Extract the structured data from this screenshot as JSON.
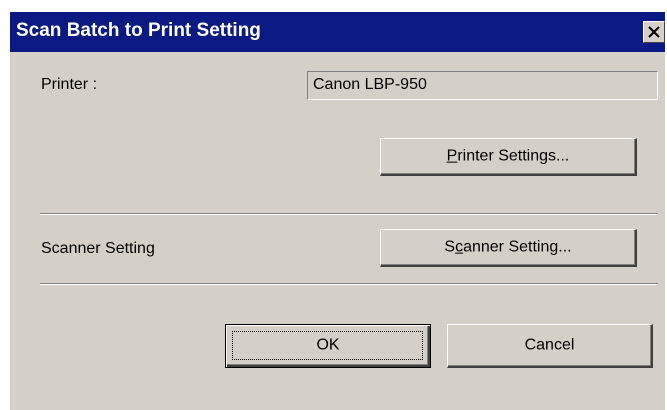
{
  "window": {
    "title": "Scan Batch to Print Setting",
    "close_icon": "close-icon"
  },
  "printer": {
    "label": "Printer :",
    "value": "Canon LBP-950",
    "settings_button": {
      "before": "",
      "mnemonic": "P",
      "after": "rinter Settings..."
    }
  },
  "scanner": {
    "label": "Scanner Setting",
    "settings_button": {
      "before": "S",
      "mnemonic": "c",
      "after": "anner Setting..."
    }
  },
  "actions": {
    "ok_label": "OK",
    "cancel_label": "Cancel"
  },
  "colors": {
    "titlebar": "#0b1a82",
    "face": "#d4d0c8"
  }
}
